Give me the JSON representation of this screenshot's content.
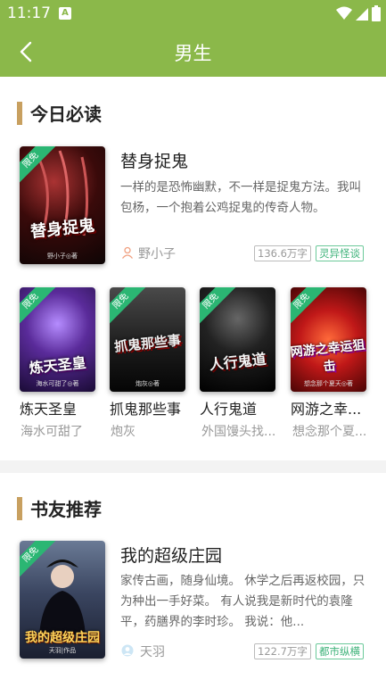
{
  "status": {
    "time": "11:17"
  },
  "header": {
    "title": "男生"
  },
  "sections": {
    "today": {
      "title": "今日必读",
      "featured": {
        "title": "替身捉鬼",
        "desc": "一样的是恐怖幽默，不一样是捉鬼方法。我叫包杨，一个抱着公鸡捉鬼的传奇人物。",
        "author": "野小子",
        "words": "136.6万字",
        "genre": "灵异怪谈",
        "cover_text": "替身捉鬼",
        "cover_sub": "野小子◎著",
        "badge": "限免"
      },
      "grid": [
        {
          "title": "炼天圣皇",
          "author": "海水可甜了",
          "cover_text": "炼天圣皇",
          "cover_sub": "海水可甜了◎著",
          "badge": "限免"
        },
        {
          "title": "抓鬼那些事",
          "author": "炮灰",
          "cover_text": "抓鬼那些事",
          "cover_sub": "炮灰◎著",
          "badge": "限免"
        },
        {
          "title": "人行鬼道",
          "author": "外国馒头找...",
          "cover_text": "人行鬼道",
          "cover_sub": "",
          "badge": "限免"
        },
        {
          "title": "网游之幸...",
          "author": "想念那个夏...",
          "cover_text": "网游之幸运狙击",
          "cover_sub": "想念那个夏天◎著",
          "badge": "限免"
        }
      ]
    },
    "recommend": {
      "title": "书友推荐",
      "featured": {
        "title": "我的超级庄园",
        "desc": "家传古画，随身仙境。 休学之后再返校园，只为种出一手好菜。 有人说我是新时代的袁隆平，药膳界的李时珍。 我说：他...",
        "author": "天羽",
        "words": "122.7万字",
        "genre": "都市纵横",
        "cover_text": "我的超级庄园",
        "cover_sub": "天羽|作品",
        "badge": "限免"
      }
    }
  },
  "colors": {
    "accent": "#8bb84a",
    "badge": "#2bb673",
    "section_bar": "#c8a060"
  }
}
